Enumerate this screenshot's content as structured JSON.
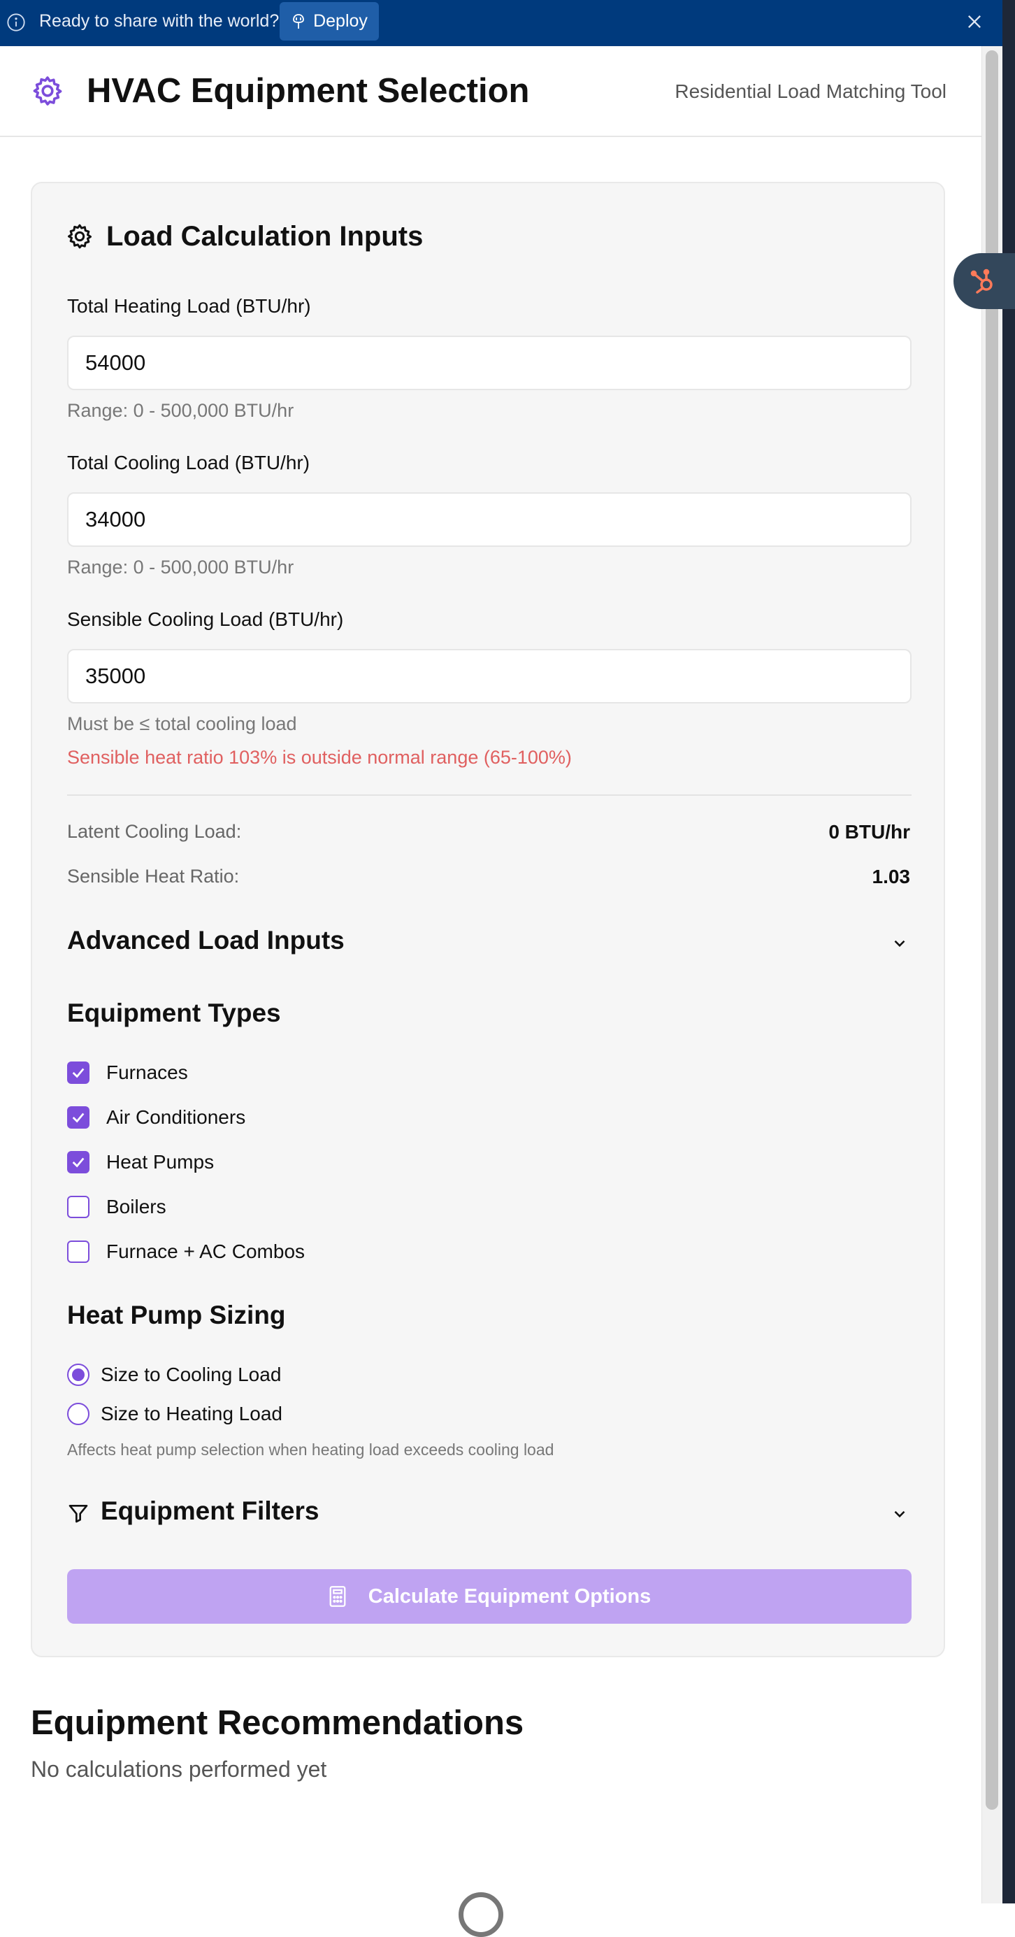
{
  "banner": {
    "text": "Ready to share with the world?",
    "deploy_label": "Deploy"
  },
  "header": {
    "title": "HVAC Equipment Selection",
    "subtitle": "Residential Load Matching Tool"
  },
  "card": {
    "title": "Load Calculation Inputs",
    "heating": {
      "label": "Total Heating Load (BTU/hr)",
      "value": "54000",
      "hint": "Range: 0 - 500,000 BTU/hr"
    },
    "cooling": {
      "label": "Total Cooling Load (BTU/hr)",
      "value": "34000",
      "hint": "Range: 0 - 500,000 BTU/hr"
    },
    "sensible": {
      "label": "Sensible Cooling Load (BTU/hr)",
      "value": "35000",
      "hint": "Must be ≤ total cooling load",
      "error": "Sensible heat ratio 103% is outside normal range (65-100%)"
    },
    "stats": {
      "latent_label": "Latent Cooling Load:",
      "latent_value": "0 BTU/hr",
      "shr_label": "Sensible Heat Ratio:",
      "shr_value": "1.03"
    },
    "advanced_title": "Advanced Load Inputs",
    "equipment_types": {
      "title": "Equipment Types",
      "items": [
        {
          "label": "Furnaces",
          "checked": true
        },
        {
          "label": "Air Conditioners",
          "checked": true
        },
        {
          "label": "Heat Pumps",
          "checked": true
        },
        {
          "label": "Boilers",
          "checked": false
        },
        {
          "label": "Furnace + AC Combos",
          "checked": false
        }
      ]
    },
    "heat_pump_sizing": {
      "title": "Heat Pump Sizing",
      "options": [
        {
          "label": "Size to Cooling Load",
          "selected": true
        },
        {
          "label": "Size to Heating Load",
          "selected": false
        }
      ],
      "hint": "Affects heat pump selection when heating load exceeds cooling load"
    },
    "filters_title": "Equipment Filters",
    "calculate_label": "Calculate Equipment Options"
  },
  "recommendations": {
    "title": "Equipment Recommendations",
    "empty": "No calculations performed yet"
  },
  "colors": {
    "accent": "#7c4ddb",
    "button_disabled": "#bfa3f2",
    "banner": "#003a7d",
    "error": "#e06060"
  }
}
